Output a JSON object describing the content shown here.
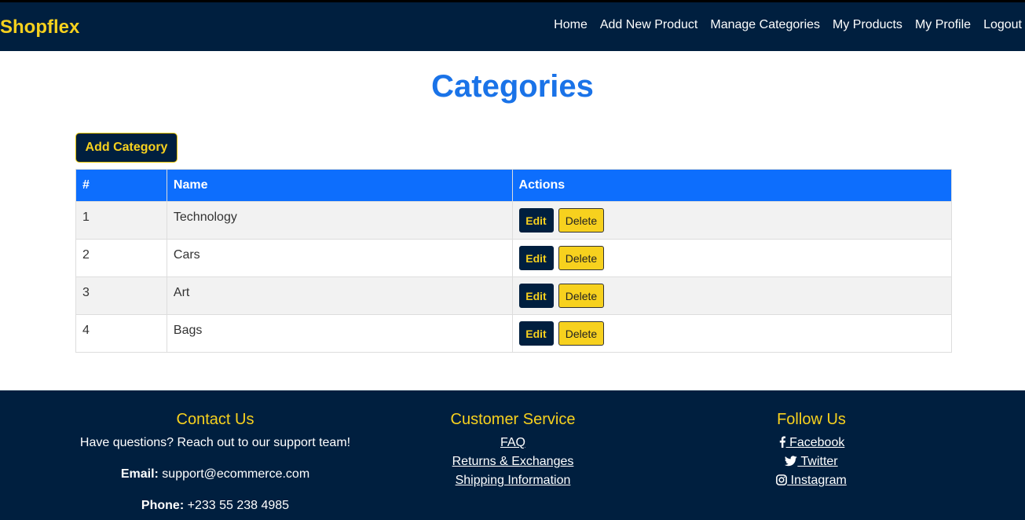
{
  "header": {
    "brand": "Shopflex",
    "nav": [
      "Home",
      "Add New Product",
      "Manage Categories",
      "My Products",
      "My Profile",
      "Logout"
    ]
  },
  "main": {
    "title": "Categories",
    "add_button": "Add Category",
    "table": {
      "headers": [
        "#",
        "Name",
        "Actions"
      ],
      "rows": [
        {
          "num": "1",
          "name": "Technology"
        },
        {
          "num": "2",
          "name": "Cars"
        },
        {
          "num": "3",
          "name": "Art"
        },
        {
          "num": "4",
          "name": "Bags"
        }
      ],
      "edit_label": "Edit",
      "delete_label": "Delete"
    }
  },
  "footer": {
    "contact": {
      "title": "Contact Us",
      "text": "Have questions? Reach out to our support team!",
      "email_label": "Email:",
      "email": "support@ecommerce.com",
      "phone_label": "Phone:",
      "phone": "+233 55 238 4985"
    },
    "service": {
      "title": "Customer Service",
      "links": [
        "FAQ",
        "Returns & Exchanges",
        "Shipping Information"
      ]
    },
    "follow": {
      "title": "Follow Us",
      "links": [
        {
          "icon": "facebook-icon",
          "label": " Facebook"
        },
        {
          "icon": "twitter-icon",
          "label": " Twitter"
        },
        {
          "icon": "instagram-icon",
          "label": " Instagram"
        }
      ]
    }
  },
  "colors": {
    "navy": "#001f3f",
    "gold": "#f7d11e",
    "blue": "#0d6efd",
    "title_blue": "#1a73e8"
  }
}
